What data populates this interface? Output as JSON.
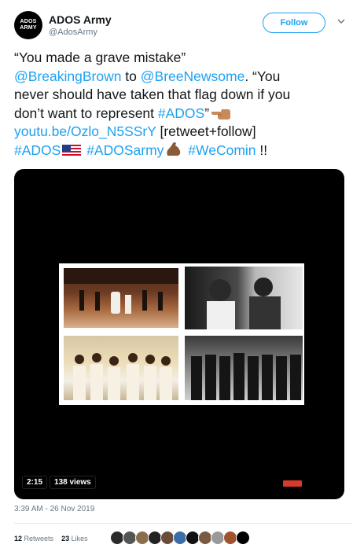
{
  "author": {
    "avatar_lines": [
      "ADOS",
      "ARMY"
    ],
    "name": "ADOS Army",
    "handle": "@AdosArmy"
  },
  "follow_label": "Follow",
  "tweet": {
    "line1": "“You made a grave mistake”",
    "line2_mention1": "@BreakingBrown",
    "line2_to": " to ",
    "line2_mention2": "@BreeNewsome",
    "line2_tail": ". “You",
    "line3": "never should have taken that flag down if you",
    "line4_text": "don’t want to represent ",
    "line4_hashtag": "#ADOS",
    "line4_quote": "”",
    "line5_link": "youtu.be/Ozlo_N5SSrY",
    "line5_tail": " [retweet+follow]",
    "line6_tag1": "#ADOS",
    "line6_tag2": "#ADOSarmy",
    "line6_tag3": "#WeComin",
    "line6_tail": " !!"
  },
  "video": {
    "duration": "2:15",
    "views": "138 views"
  },
  "timestamp": "3:39 AM - 26 Nov 2019",
  "stats": {
    "retweets_count": "12",
    "retweets_label": "Retweets",
    "likes_count": "23",
    "likes_label": "Likes"
  },
  "liker_colors": [
    "#2b2b2b",
    "#555",
    "#8a6e4b",
    "#222",
    "#6b4b3a",
    "#3a6ea5",
    "#111",
    "#7a5a40",
    "#999",
    "#a0522d",
    "#000"
  ],
  "colors": {
    "accent": "#1da1f2",
    "text": "#14171a",
    "muted": "#657786"
  },
  "icons": {
    "chevron": "chevron-down-icon",
    "point_left": "backhand-index-pointing-left-icon",
    "flag": "us-flag-icon",
    "muscle": "flexed-biceps-icon"
  }
}
